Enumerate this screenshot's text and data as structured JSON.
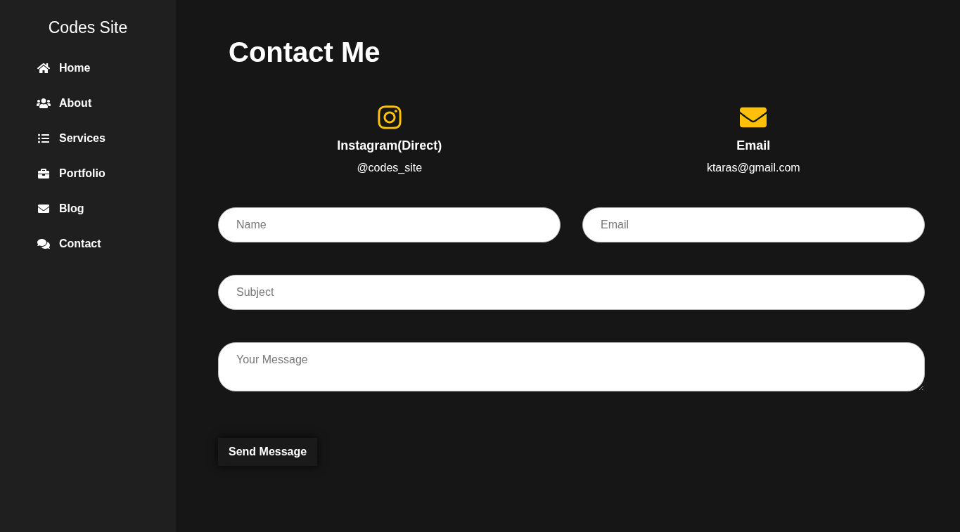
{
  "sidebar": {
    "title": "Codes Site",
    "items": [
      {
        "label": "Home"
      },
      {
        "label": "About"
      },
      {
        "label": "Services"
      },
      {
        "label": "Portfolio"
      },
      {
        "label": "Blog"
      },
      {
        "label": "Contact"
      }
    ]
  },
  "heading": "Contact Me",
  "contacts": [
    {
      "title": "Instagram(Direct)",
      "value": "@codes_site"
    },
    {
      "title": "Email",
      "value": "ktaras@gmail.com"
    }
  ],
  "form": {
    "name": {
      "placeholder": "Name"
    },
    "email": {
      "placeholder": "Email"
    },
    "subject": {
      "placeholder": "Subject"
    },
    "message": {
      "placeholder": "Your Message"
    },
    "submit": "Send Message"
  }
}
